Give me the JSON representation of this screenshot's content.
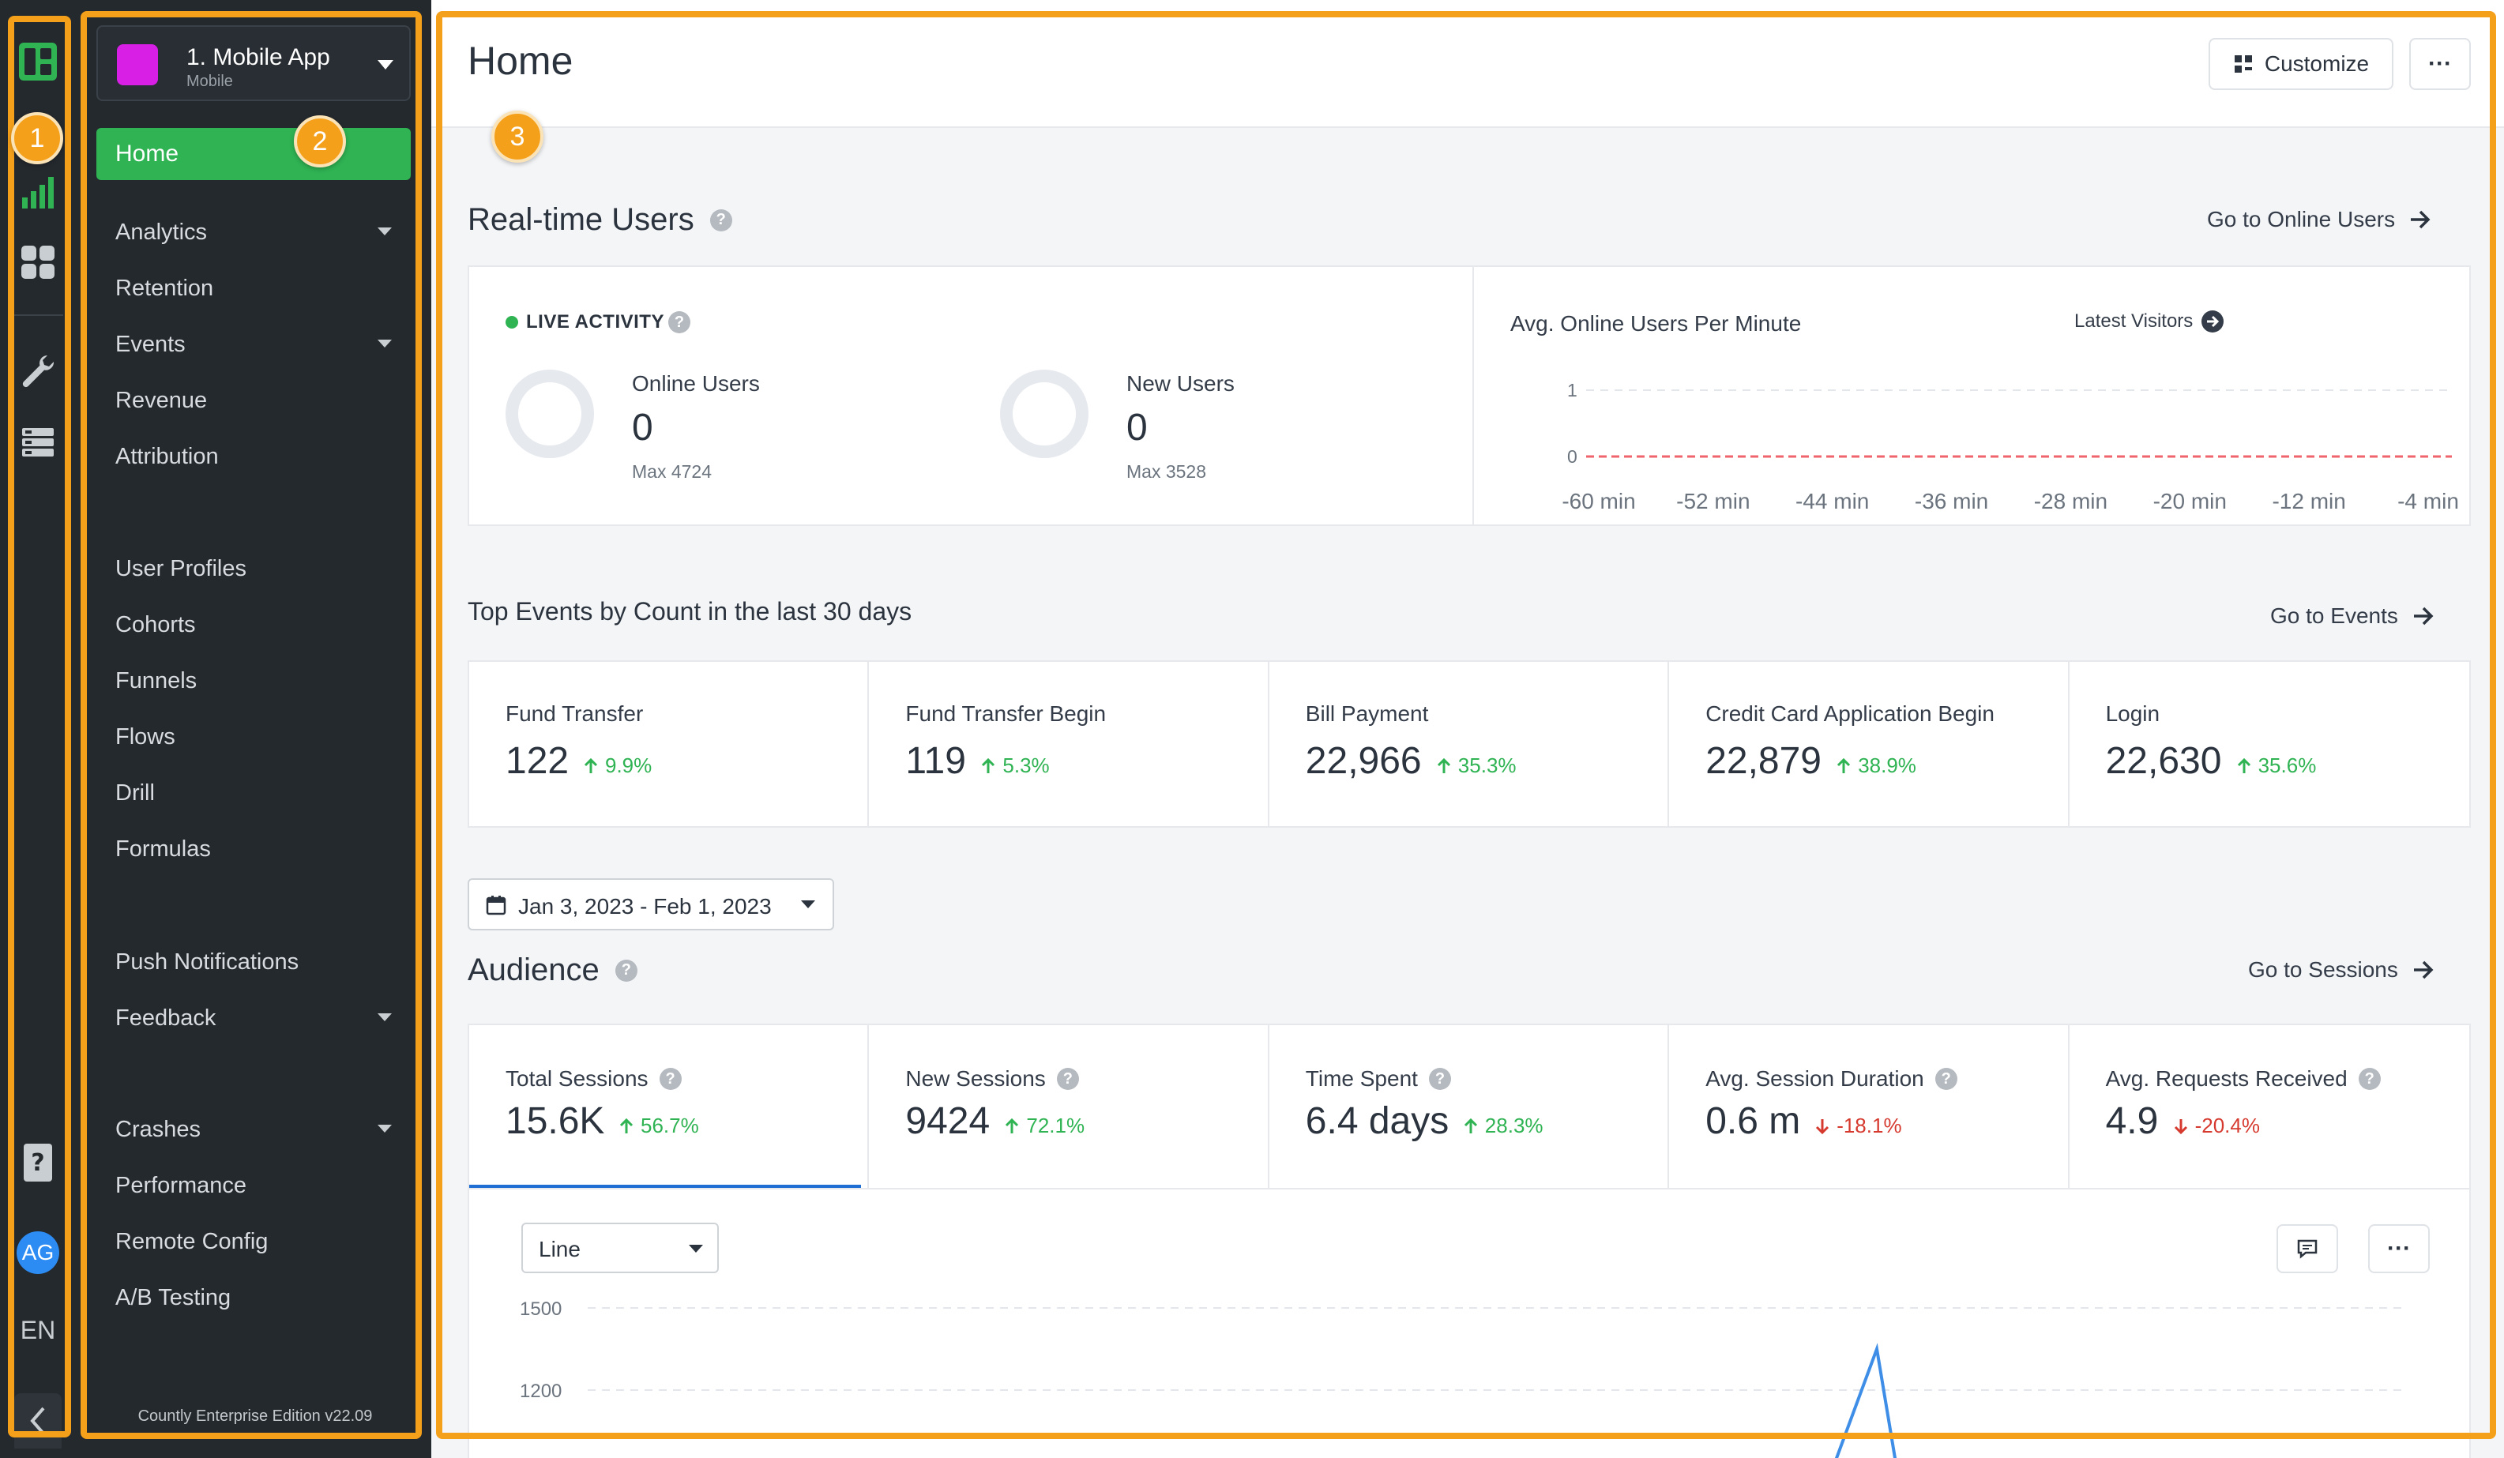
{
  "colors": {
    "accent": "#2fb353",
    "highlight": "#f5a01a",
    "rail_bg": "#24292e",
    "app_logo": "#d81fe6",
    "trend_down": "#d63a2f",
    "active_tab": "#1f6ed4"
  },
  "rail": {
    "icons": [
      "countly-logo-icon",
      "analytics-bar-icon",
      "dashboard-grid-icon",
      "wrench-icon",
      "data-manager-icon",
      "help-icon"
    ],
    "avatar": "AG",
    "language": "EN"
  },
  "sidebar": {
    "app_name": "1. Mobile App",
    "app_type": "Mobile",
    "home": "Home",
    "groups": [
      [
        {
          "label": "Analytics",
          "caret": true
        },
        {
          "label": "Retention"
        },
        {
          "label": "Events",
          "caret": true
        },
        {
          "label": "Revenue"
        },
        {
          "label": "Attribution"
        }
      ],
      [
        {
          "label": "User Profiles"
        },
        {
          "label": "Cohorts"
        },
        {
          "label": "Funnels"
        },
        {
          "label": "Flows"
        },
        {
          "label": "Drill"
        },
        {
          "label": "Formulas"
        }
      ],
      [
        {
          "label": "Push Notifications"
        },
        {
          "label": "Feedback",
          "caret": true
        }
      ],
      [
        {
          "label": "Crashes",
          "caret": true
        },
        {
          "label": "Performance"
        },
        {
          "label": "Remote Config"
        },
        {
          "label": "A/B Testing"
        }
      ]
    ],
    "edition": "Countly Enterprise Edition v22.09"
  },
  "header": {
    "title": "Home",
    "customize": "Customize",
    "more": "···"
  },
  "realtime": {
    "title": "Real-time Users",
    "goto": "Go to Online Users",
    "live_label": "LIVE ACTIVITY",
    "online": {
      "name": "Online Users",
      "value": "0",
      "max": "Max 4724"
    },
    "new": {
      "name": "New Users",
      "value": "0",
      "max": "Max 3528"
    },
    "chart_title": "Avg. Online Users Per Minute",
    "latest_visitors": "Latest Visitors",
    "y_ticks": [
      "1",
      "0"
    ],
    "x_ticks": [
      "-60 min",
      "-52 min",
      "-44 min",
      "-36 min",
      "-28 min",
      "-20 min",
      "-12 min",
      "-4 min"
    ]
  },
  "top_events": {
    "title": "Top Events by Count in the last 30 days",
    "goto": "Go to Events",
    "items": [
      {
        "name": "Fund Transfer",
        "value": "122",
        "trend": "9.9%",
        "dir": "up"
      },
      {
        "name": "Fund Transfer Begin",
        "value": "119",
        "trend": "5.3%",
        "dir": "up"
      },
      {
        "name": "Bill Payment",
        "value": "22,966",
        "trend": "35.3%",
        "dir": "up"
      },
      {
        "name": "Credit Card Application Begin",
        "value": "22,879",
        "trend": "38.9%",
        "dir": "up"
      },
      {
        "name": "Login",
        "value": "22,630",
        "trend": "35.6%",
        "dir": "up"
      }
    ]
  },
  "date_range": "Jan 3, 2023 - Feb 1, 2023",
  "audience": {
    "title": "Audience",
    "goto": "Go to Sessions",
    "items": [
      {
        "name": "Total Sessions",
        "value": "15.6K",
        "trend": "56.7%",
        "dir": "up"
      },
      {
        "name": "New Sessions",
        "value": "9424",
        "trend": "72.1%",
        "dir": "up"
      },
      {
        "name": "Time Spent",
        "value": "6.4 days",
        "trend": "28.3%",
        "dir": "up"
      },
      {
        "name": "Avg. Session Duration",
        "value": "0.6 m",
        "trend": "-18.1%",
        "dir": "down"
      },
      {
        "name": "Avg. Requests Received",
        "value": "4.9",
        "trend": "-20.4%",
        "dir": "down"
      }
    ],
    "chart_type": "Line",
    "y_ticks": [
      "1500",
      "1200"
    ]
  },
  "badges": [
    "1",
    "2",
    "3"
  ]
}
